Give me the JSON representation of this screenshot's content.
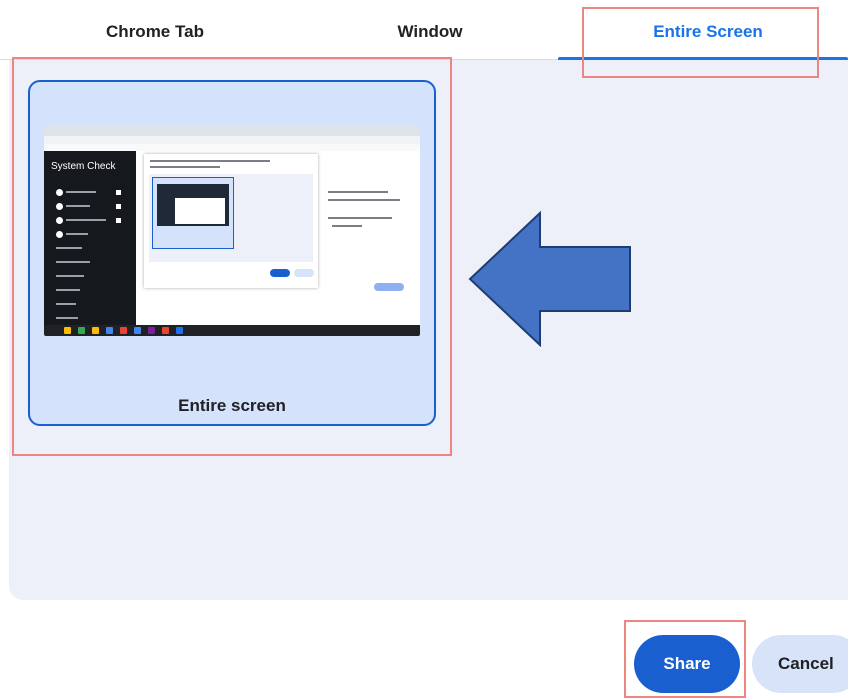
{
  "tabs": [
    {
      "label": "Chrome Tab",
      "active": false
    },
    {
      "label": "Window",
      "active": false
    },
    {
      "label": "Entire Screen",
      "active": true
    }
  ],
  "source_card": {
    "label": "Entire screen",
    "thumbnail": {
      "sidebar_title": "System Check"
    }
  },
  "buttons": {
    "share": "Share",
    "cancel": "Cancel"
  },
  "colors": {
    "accent": "#1a73e8",
    "primary_button": "#1a5fd0",
    "card_bg": "#d4e2fb",
    "panel_bg": "#edf0f9",
    "arrow_fill": "#4472c4",
    "highlight_border": "#ec8680"
  },
  "icons": {
    "arrow": "arrow-left-icon"
  }
}
